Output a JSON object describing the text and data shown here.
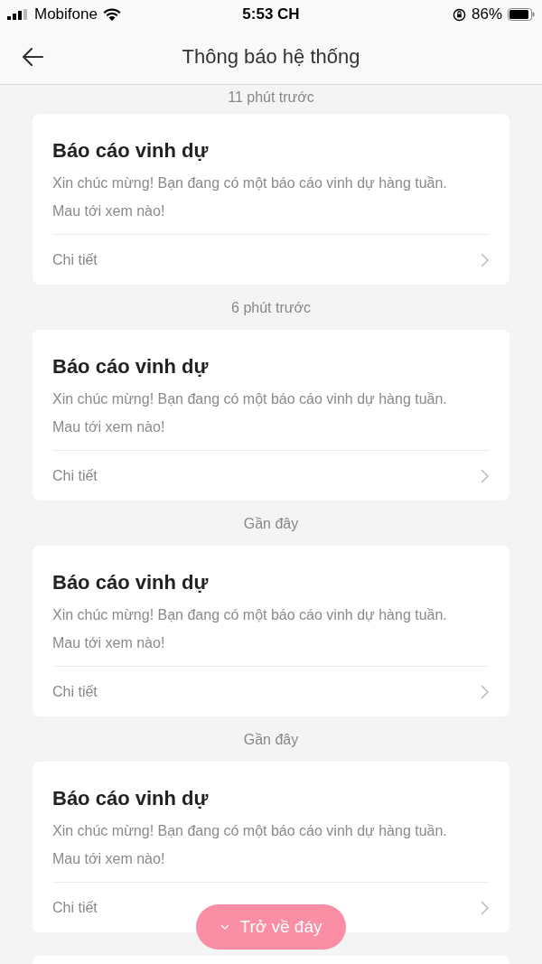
{
  "status_bar": {
    "carrier": "Mobifone",
    "time": "5:53 CH",
    "battery": "86%"
  },
  "header": {
    "title": "Thông báo hệ thống"
  },
  "notifications": [
    {
      "time": "11 phút trước",
      "title": "Báo cáo vinh dự",
      "body": "Xin chúc mừng! Bạn đang có một báo cáo vinh dự hàng tuần. Mau tới xem nào!",
      "link": "Chi tiết"
    },
    {
      "time": "6 phút trước",
      "title": "Báo cáo vinh dự",
      "body": "Xin chúc mừng! Bạn đang có một báo cáo vinh dự hàng tuần. Mau tới xem nào!",
      "link": "Chi tiết"
    },
    {
      "time": "Gần đây",
      "title": "Báo cáo vinh dự",
      "body": "Xin chúc mừng! Bạn đang có một báo cáo vinh dự hàng tuần. Mau tới xem nào!",
      "link": "Chi tiết"
    },
    {
      "time": "Gần đây",
      "title": "Báo cáo vinh dự",
      "body": "Xin chúc mừng! Bạn đang có một báo cáo vinh dự hàng tuần. Mau tới xem nào!",
      "link": "Chi tiết"
    }
  ],
  "scroll_button": {
    "label": "Trở về đáy"
  }
}
